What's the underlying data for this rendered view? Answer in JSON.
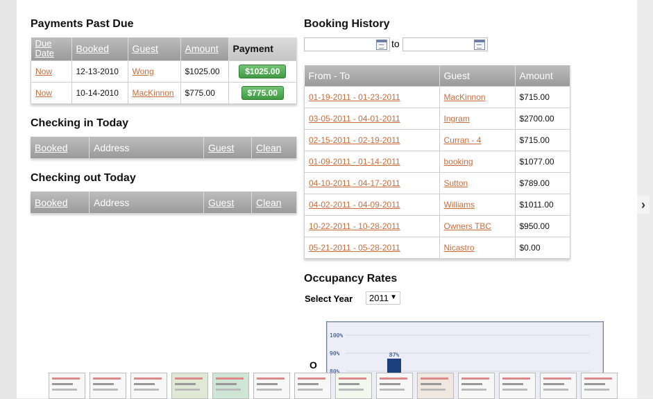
{
  "past_due": {
    "title": "Payments Past Due",
    "headers": [
      "Due Date",
      "Booked",
      "Guest",
      "Amount",
      "Payment"
    ],
    "rows": [
      {
        "due": "Now",
        "booked": "12-13-2010",
        "guest": "Wong",
        "amount": "$1025.00",
        "payment": "$1025.00"
      },
      {
        "due": "Now",
        "booked": "10-14-2010",
        "guest": "MacKinnon",
        "amount": "$775.00",
        "payment": "$775.00"
      }
    ]
  },
  "checking_in": {
    "title": "Checking in Today",
    "headers": [
      "Booked",
      "Address",
      "Guest",
      "Clean"
    ]
  },
  "checking_out": {
    "title": "Checking out Today",
    "headers": [
      "Booked",
      "Address",
      "Guest",
      "Clean"
    ]
  },
  "history": {
    "title": "Booking History",
    "to_label": "to",
    "headers": [
      "From - To",
      "Guest",
      "Amount"
    ],
    "rows": [
      {
        "range": "01-19-2011 - 01-23-2011",
        "guest": "MacKinnon",
        "amount": "$715.00"
      },
      {
        "range": "03-05-2011 - 04-01-2011",
        "guest": "Ingram",
        "amount": "$2700.00"
      },
      {
        "range": "02-15-2011 - 02-19-2011",
        "guest": "Curran - 4",
        "amount": "$715.00"
      },
      {
        "range": "01-09-2011 - 01-14-2011",
        "guest": "booking",
        "amount": "$1077.00"
      },
      {
        "range": "04-10-2011 - 04-17-2011",
        "guest": "Sutton",
        "amount": "$789.00"
      },
      {
        "range": "04-02-2011 - 04-09-2011",
        "guest": "Williams",
        "amount": "$1011.00"
      },
      {
        "range": "10-22-2011 - 10-28-2011",
        "guest": "Owners TBC",
        "amount": "$950.00"
      },
      {
        "range": "05-21-2011 - 05-28-2011",
        "guest": "Nicastro",
        "amount": "$0.00"
      }
    ]
  },
  "occupancy": {
    "title": "Occupancy Rates",
    "select_label": "Select Year",
    "year": "2011",
    "side_letter": "O"
  },
  "chart_data": {
    "type": "bar",
    "ytick_labels": [
      "100%",
      "90%",
      "80%"
    ],
    "ylim": [
      80,
      100
    ],
    "values": [
      87
    ],
    "data_labels": [
      "87%"
    ],
    "bar_color": "#1a3f7a"
  },
  "icons": {
    "next": "chevron-right-icon",
    "calendar": "calendar-icon",
    "dropdown": "caret-down-icon"
  }
}
